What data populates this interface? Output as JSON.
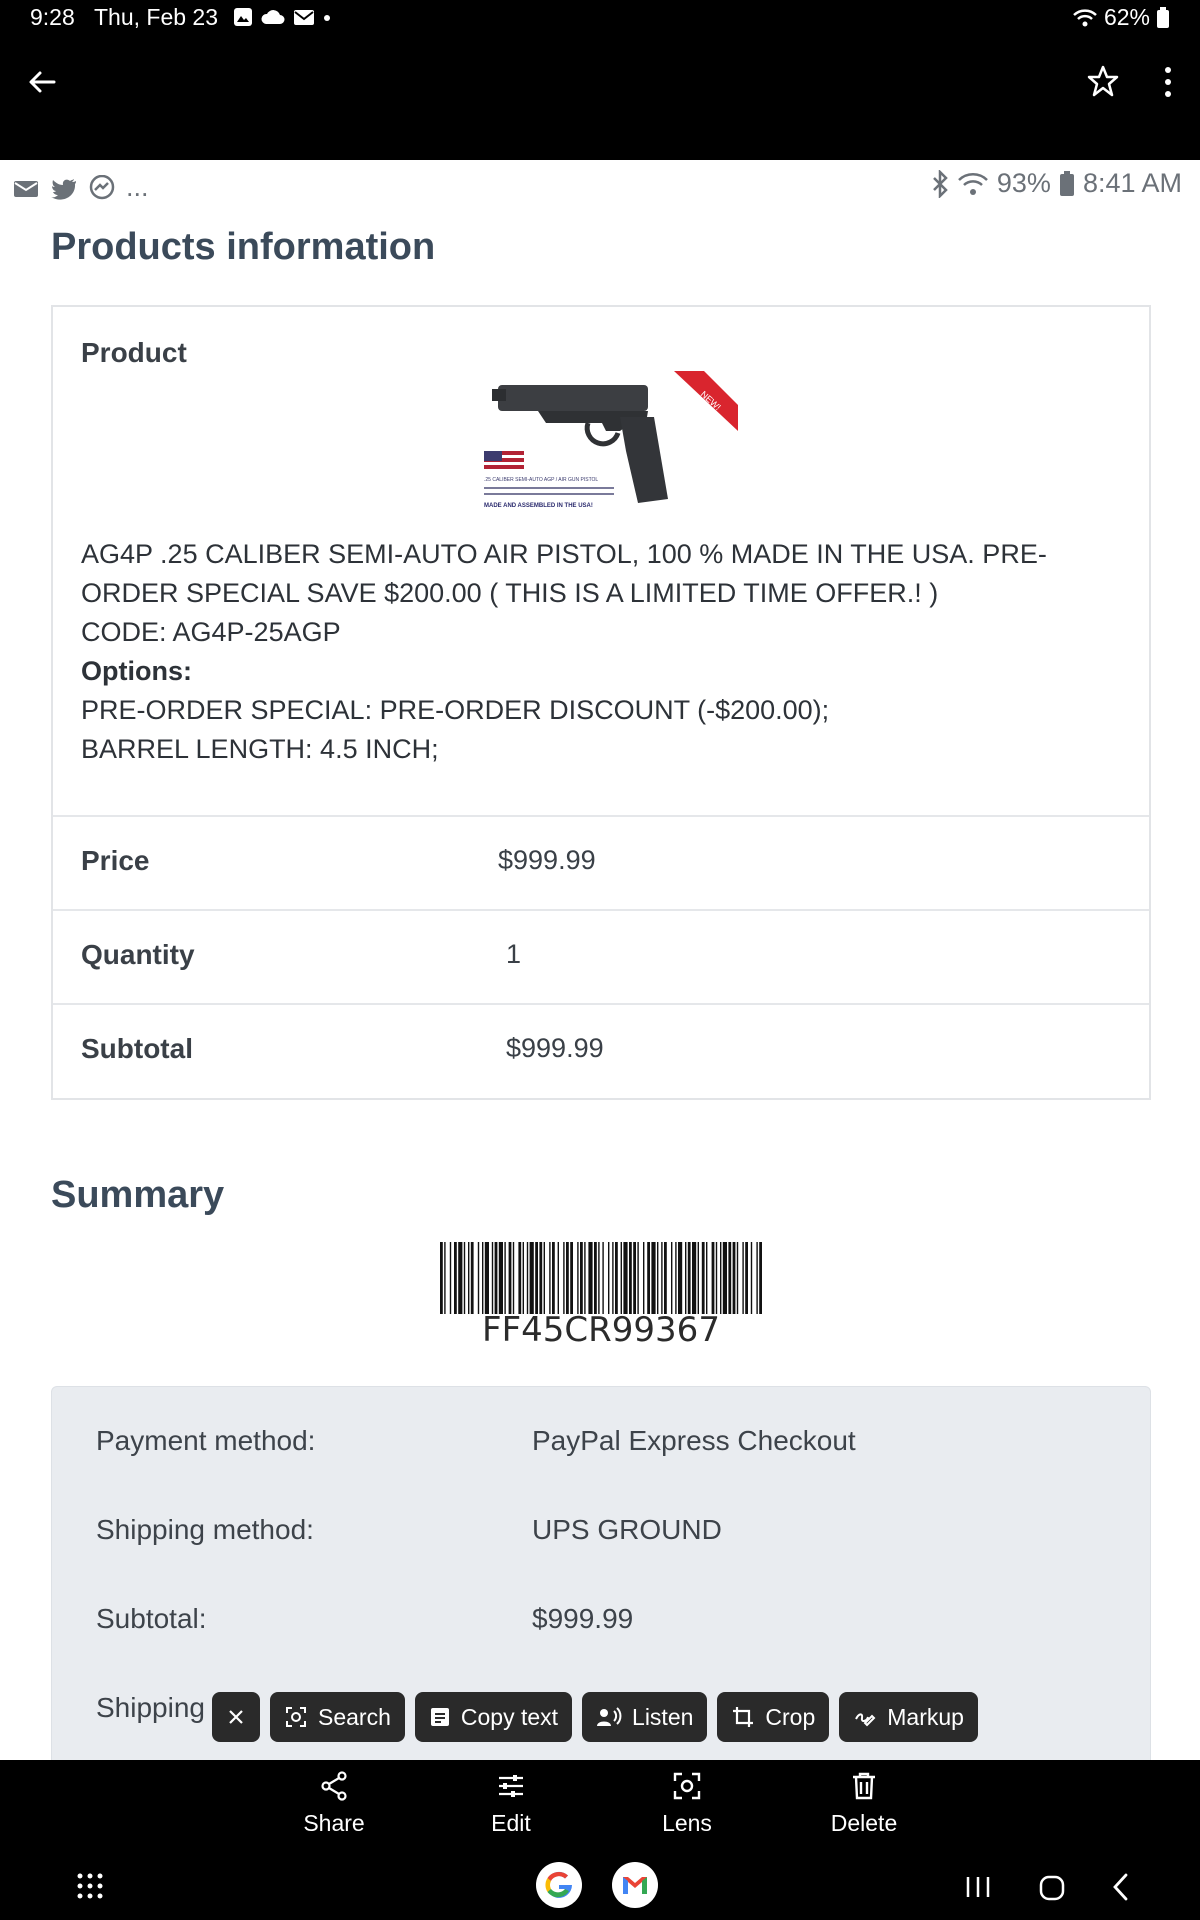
{
  "system": {
    "time": "9:28",
    "date": "Thu, Feb 23",
    "battery": "62%"
  },
  "inner_status": {
    "ellipsis": "...",
    "battery": "93%",
    "time": "8:41 AM"
  },
  "products": {
    "title": "Products information",
    "product_label": "Product",
    "badge": "NEW!",
    "image_caption_1": ".25 CALIBER SEMI-AUTO AGP / AIR GUN PISTOL",
    "image_caption_2": "MADE AND ASSEMBLED IN THE USA!",
    "description": "AG4P .25 CALIBER SEMI-AUTO AIR PISTOL, 100 % MADE IN THE USA. PRE-ORDER SPECIAL SAVE $200.00 ( THIS IS A LIMITED TIME OFFER.! )",
    "code": "CODE: AG4P-25AGP",
    "options_label": "Options:",
    "option_1": "PRE-ORDER SPECIAL: PRE-ORDER DISCOUNT (-$200.00);",
    "option_2": "BARREL LENGTH: 4.5 INCH;",
    "price_label": "Price",
    "price_value": "$999.99",
    "quantity_label": "Quantity",
    "quantity_value": "1",
    "subtotal_label": "Subtotal",
    "subtotal_value": "$999.99"
  },
  "summary": {
    "title": "Summary",
    "barcode": "FF45CR99367",
    "rows": [
      {
        "label": "Payment method:",
        "value": "PayPal Express Checkout"
      },
      {
        "label": "Shipping method:",
        "value": "UPS GROUND"
      },
      {
        "label": "Subtotal:",
        "value": "$999.99"
      },
      {
        "label": "Shipping",
        "value": ""
      }
    ]
  },
  "chips": {
    "search": "Search",
    "copy_text": "Copy text",
    "listen": "Listen",
    "crop": "Crop",
    "markup": "Markup"
  },
  "bottom_actions": {
    "share": "Share",
    "edit": "Edit",
    "lens": "Lens",
    "delete": "Delete"
  }
}
